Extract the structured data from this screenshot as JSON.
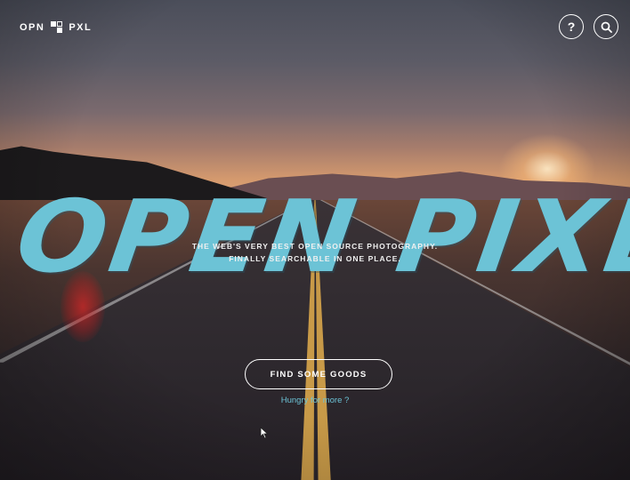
{
  "header": {
    "logo_left": "OPN",
    "logo_right": "PXL",
    "help_icon": "?",
    "search_icon": "search-icon"
  },
  "hero": {
    "title": "OPEN PIXEL",
    "tagline_line1": "THE WEB'S VERY BEST OPEN SOURCE PHOTOGRAPHY.",
    "tagline_line2": "FINALLY SEARCHABLE IN ONE PLACE.",
    "cta_label": "FIND SOME GOODS",
    "more_link": "Hungry for more ?"
  },
  "colors": {
    "accent": "#6cc3d6",
    "text": "#ffffff"
  }
}
